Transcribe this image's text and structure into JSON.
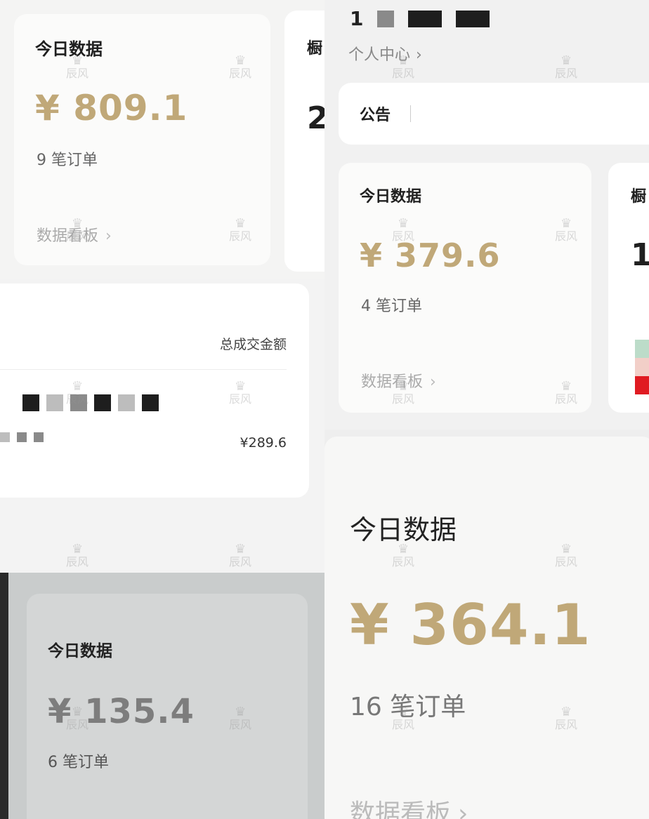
{
  "top_left": {
    "card_title": "今日数据",
    "amount": "¥ 809.1",
    "orders": "9 笔订单",
    "link": "数据看板",
    "right_card_title_partial": "橱",
    "right_card_value_partial": "2"
  },
  "middle_left": {
    "column_header": "总成交金额",
    "row_amount": "¥289.6"
  },
  "bottom_left": {
    "card_title": "今日数据",
    "amount": "¥ 135.4",
    "orders": "6 笔订单"
  },
  "top_right": {
    "profile_name_partial": "1",
    "profile_link": "个人中心",
    "announcement_label": "公告",
    "card_title": "今日数据",
    "amount": "¥ 379.6",
    "orders": "4 笔订单",
    "link": "数据看板",
    "right_card_title_partial": "橱",
    "right_card_value_partial": "1"
  },
  "bottom_right": {
    "card_title": "今日数据",
    "amount": "¥ 364.1",
    "orders": "16 笔订单",
    "link": "数据看板"
  },
  "watermark": {
    "text": "辰风",
    "icon": "crown-icon"
  },
  "colors": {
    "amount_gold": "#c0a878",
    "title_dark": "#1f1f1f",
    "muted_gray": "#aaaaaa"
  }
}
